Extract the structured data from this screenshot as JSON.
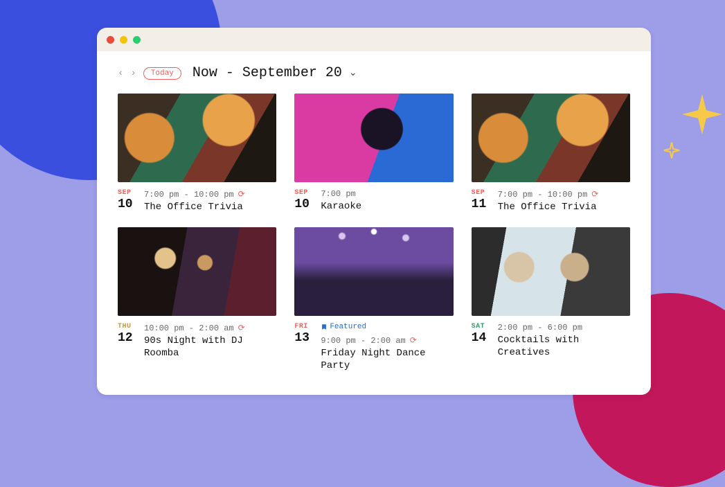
{
  "toolbar": {
    "today_label": "Today",
    "range_label": "Now - September 20"
  },
  "events": [
    {
      "dow": "SEP",
      "dow_class": "sep",
      "day": "10",
      "time": "7:00 pm - 10:00 pm",
      "recurring": true,
      "featured": false,
      "title": "The Office Trivia",
      "thumb": "trivia"
    },
    {
      "dow": "SEP",
      "dow_class": "sep",
      "day": "10",
      "time": "7:00 pm",
      "recurring": false,
      "featured": false,
      "title": "Karaoke",
      "thumb": "karaoke"
    },
    {
      "dow": "SEP",
      "dow_class": "sep",
      "day": "11",
      "time": "7:00 pm - 10:00 pm",
      "recurring": true,
      "featured": false,
      "title": "The Office Trivia",
      "thumb": "trivia"
    },
    {
      "dow": "THU",
      "dow_class": "thu",
      "day": "12",
      "time": "10:00 pm - 2:00 am",
      "recurring": true,
      "featured": false,
      "title": "90s Night with DJ Roomba",
      "thumb": "nineties"
    },
    {
      "dow": "FRI",
      "dow_class": "sep",
      "day": "13",
      "time": "9:00 pm - 2:00 am",
      "recurring": true,
      "featured": true,
      "featured_label": "Featured",
      "title": "Friday Night Dance Party",
      "thumb": "concert"
    },
    {
      "dow": "SAT",
      "dow_class": "sat",
      "day": "14",
      "time": "2:00 pm - 6:00 pm",
      "recurring": false,
      "featured": false,
      "title": "Cocktails with Creatives",
      "thumb": "cocktails"
    }
  ]
}
